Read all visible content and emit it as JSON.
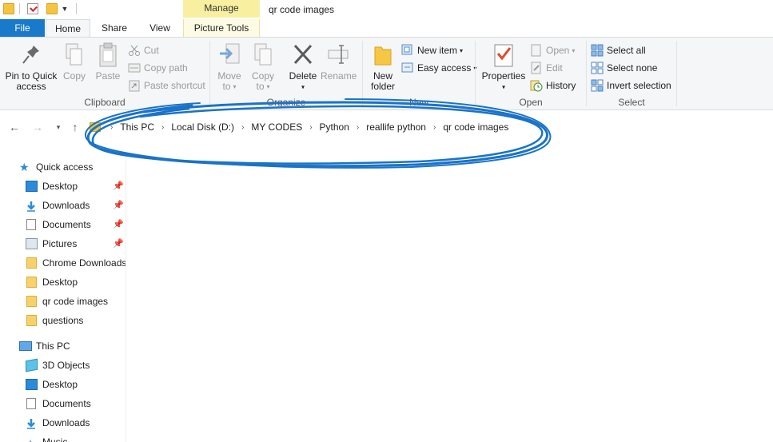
{
  "window": {
    "title": "qr code images",
    "contextual_tab_group": "Manage"
  },
  "tabs": {
    "file": "File",
    "home": "Home",
    "share": "Share",
    "view": "View",
    "picture_tools": "Picture Tools"
  },
  "ribbon": {
    "clipboard": {
      "label": "Clipboard",
      "pin": "Pin to Quick\naccess",
      "copy": "Copy",
      "paste": "Paste",
      "cut": "Cut",
      "copy_path": "Copy path",
      "paste_shortcut": "Paste shortcut"
    },
    "organize": {
      "label": "Organize",
      "move_to": "Move\nto",
      "copy_to": "Copy\nto",
      "delete": "Delete",
      "rename": "Rename"
    },
    "new": {
      "label": "New",
      "new_folder": "New\nfolder",
      "new_item": "New item",
      "easy_access": "Easy access"
    },
    "open": {
      "label": "Open",
      "properties": "Properties",
      "open": "Open",
      "edit": "Edit",
      "history": "History"
    },
    "select": {
      "label": "Select",
      "select_all": "Select all",
      "select_none": "Select none",
      "invert_selection": "Invert selection"
    }
  },
  "address": {
    "crumbs": [
      "This PC",
      "Local Disk (D:)",
      "MY CODES",
      "Python",
      "reallife python",
      "qr code images"
    ]
  },
  "navpane": {
    "quick_access": "Quick access",
    "quick_items": [
      "Desktop",
      "Downloads",
      "Documents",
      "Pictures",
      "Chrome Downloads",
      "Desktop",
      "qr code images",
      "questions"
    ],
    "this_pc": "This PC",
    "pc_items": [
      "3D Objects",
      "Desktop",
      "Documents",
      "Downloads",
      "Music"
    ]
  },
  "colors": {
    "file_tab": "#1979ca",
    "manage_tab": "#f8f0a0",
    "annotation": "#1a73c8"
  }
}
